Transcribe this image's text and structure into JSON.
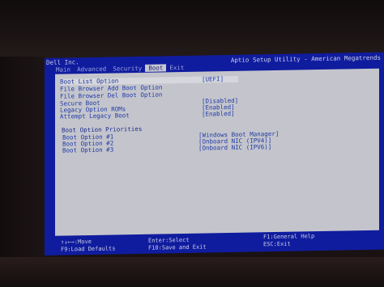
{
  "header": {
    "brand": "Dell Inc.",
    "utility_title": "Aptio Setup Utility - American Megatrends",
    "tabs": [
      {
        "label": "Main"
      },
      {
        "label": "Advanced"
      },
      {
        "label": "Security"
      },
      {
        "label": "Boot",
        "active": true
      },
      {
        "label": "Exit"
      }
    ]
  },
  "boot": {
    "boot_list_option": {
      "label": "Boot List Option",
      "value": "[UEFI]"
    },
    "add_boot_option": "File Browser Add Boot Option",
    "del_boot_option": "File Browser Del Boot Option",
    "secure_boot": {
      "label": "Secure Boot",
      "value": "[Disabled]"
    },
    "legacy_option_roms": {
      "label": "Legacy Option ROMs",
      "value": "[Enabled]"
    },
    "attempt_legacy_boot": {
      "label": "Attempt Legacy Boot",
      "value": "[Enabled]"
    },
    "priorities_heading": "Boot Option Priorities",
    "options": [
      {
        "label": "Boot Option #1",
        "value": "[Windows Boot Manager]"
      },
      {
        "label": "Boot Option #2",
        "value": "[Onboard NIC (IPV4)]"
      },
      {
        "label": "Boot Option #3",
        "value": "[Onboard NIC (IPV6)]"
      }
    ]
  },
  "help": {
    "move": "↑↓←→:Move",
    "load_defaults": "F9:Load Defaults",
    "enter_select": "Enter:Select",
    "save_exit": "F10:Save and Exit",
    "general_help": "F1:General Help",
    "esc_exit": "ESC:Exit"
  },
  "colors": {
    "screen_blue": "#101c9e",
    "panel_gray": "#c4c5cc",
    "text_blue": "#1f3aa8"
  }
}
